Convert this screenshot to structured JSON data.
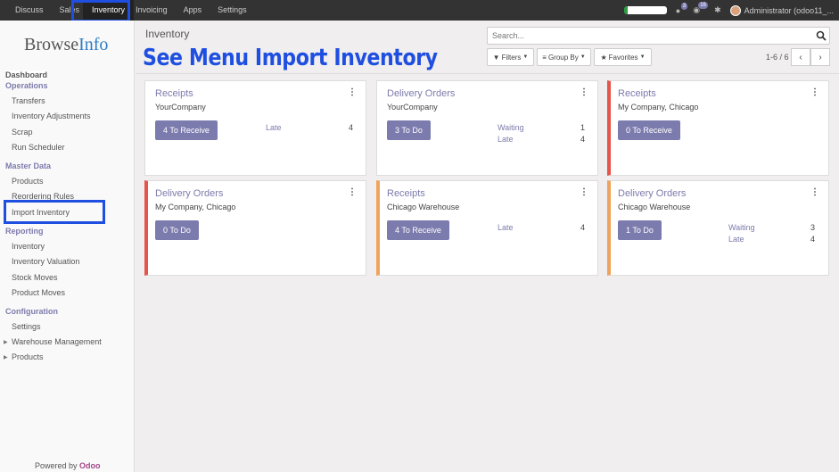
{
  "topbar": {
    "menu": [
      "Discuss",
      "Sales",
      "Inventory",
      "Invoicing",
      "Apps",
      "Settings"
    ],
    "active": "Inventory",
    "chat_count": "3",
    "activity_count": "16",
    "user": "Administrator (odoo11_..."
  },
  "sidebar": {
    "logo_main": "Browse",
    "logo_accent": "Info",
    "sections": {
      "dashboard": "Dashboard",
      "operations": "Operations",
      "master_data": "Master Data",
      "reporting": "Reporting",
      "configuration": "Configuration"
    },
    "operations_items": [
      "Transfers",
      "Inventory Adjustments",
      "Scrap",
      "Run Scheduler"
    ],
    "master_items": [
      "Products",
      "Reordering Rules",
      "Import Inventory"
    ],
    "reporting_items": [
      "Inventory",
      "Inventory Valuation",
      "Stock Moves",
      "Product Moves"
    ],
    "config_items": [
      "Settings",
      "Warehouse Management",
      "Products"
    ],
    "powered_by": "Powered by",
    "powered_brand": "Odoo"
  },
  "control": {
    "breadcrumb": "Inventory",
    "overlay_title": "See Menu Import Inventory",
    "search_placeholder": "Search...",
    "filters": "Filters",
    "group_by": "Group By",
    "favorites": "Favorites",
    "pager": "1-6 / 6"
  },
  "cards": [
    {
      "title": "Receipts",
      "company": "YourCompany",
      "button": "4 To Receive",
      "stats": [
        {
          "label": "Late",
          "value": "4"
        }
      ],
      "accent": "none"
    },
    {
      "title": "Delivery Orders",
      "company": "YourCompany",
      "button": "3 To Do",
      "stats": [
        {
          "label": "Waiting",
          "value": "1"
        },
        {
          "label": "Late",
          "value": "4"
        }
      ],
      "accent": "none"
    },
    {
      "title": "Receipts",
      "company": "My Company, Chicago",
      "button": "0 To Receive",
      "stats": [],
      "accent": "red"
    },
    {
      "title": "Delivery Orders",
      "company": "My Company, Chicago",
      "button": "0 To Do",
      "stats": [],
      "accent": "red"
    },
    {
      "title": "Receipts",
      "company": "Chicago Warehouse",
      "button": "4 To Receive",
      "stats": [
        {
          "label": "Late",
          "value": "4"
        }
      ],
      "accent": "orange"
    },
    {
      "title": "Delivery Orders",
      "company": "Chicago Warehouse",
      "button": "1 To Do",
      "stats": [
        {
          "label": "Waiting",
          "value": "3"
        },
        {
          "label": "Late",
          "value": "4"
        }
      ],
      "accent": "orange"
    }
  ],
  "colors": {
    "accent": "#7c7bad",
    "highlight": "#1f4fe0",
    "red": "#e5554b",
    "orange": "#f0a35c"
  },
  "kebab": "⋮"
}
